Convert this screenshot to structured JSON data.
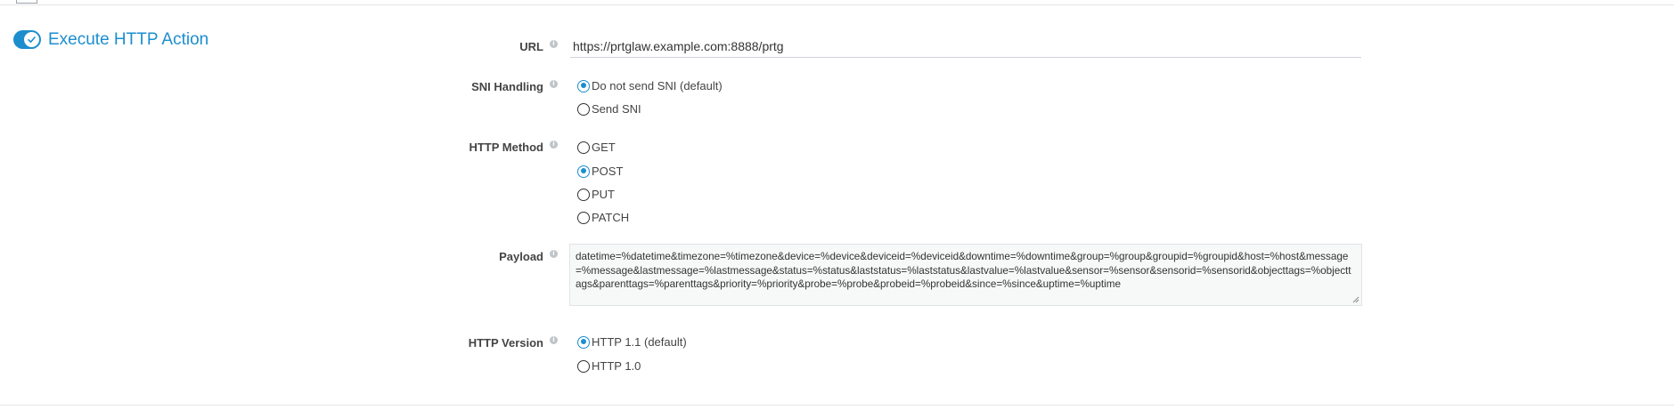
{
  "section": {
    "title": "Execute HTTP Action",
    "enabled": true
  },
  "fields": {
    "url": {
      "label": "URL",
      "value": "https://prtglaw.example.com:8888/prtg"
    },
    "sni": {
      "label": "SNI Handling",
      "options": [
        "Do not send SNI (default)",
        "Send SNI"
      ],
      "selected": "Do not send SNI (default)"
    },
    "method": {
      "label": "HTTP Method",
      "options": [
        "GET",
        "POST",
        "PUT",
        "PATCH"
      ],
      "selected": "POST"
    },
    "payload": {
      "label": "Payload",
      "value": "datetime=%datetime&timezone=%timezone&device=%device&deviceid=%deviceid&downtime=%downtime&group=%group&groupid=%groupid&host=%host&message=%message&lastmessage=%lastmessage&status=%status&laststatus=%laststatus&lastvalue=%lastvalue&sensor=%sensor&sensorid=%sensorid&objecttags=%objecttags&parenttags=%parenttags&priority=%priority&probe=%probe&probeid=%probeid&since=%since&uptime=%uptime"
    },
    "version": {
      "label": "HTTP Version",
      "options": [
        "HTTP 1.1 (default)",
        "HTTP 1.0"
      ],
      "selected": "HTTP 1.1 (default)"
    }
  },
  "icons": {
    "info": "info-icon",
    "toggle": "toggle-switch",
    "check": "check-icon"
  },
  "colors": {
    "accent": "#1c8ece",
    "label": "#444444",
    "border": "#e4e4e4"
  }
}
